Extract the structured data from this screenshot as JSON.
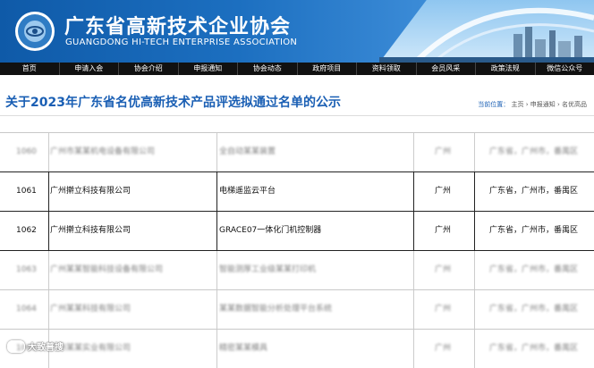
{
  "header": {
    "title_cn": "广东省高新技术企业协会",
    "title_en": "GUANGDONG HI-TECH ENTERPRISE ASSOCIATION",
    "logo_text": "GUANGDONG HI-TECH ENTERPRISE ASSOCIATION",
    "brand_color": "#1c6fc0"
  },
  "nav": {
    "items": [
      "首页",
      "申请入会",
      "协会介绍",
      "申报通知",
      "协会动态",
      "政府项目",
      "资料领取",
      "会员风采",
      "政策法规",
      "微信公众号"
    ]
  },
  "page": {
    "title": "关于2023年广东省名优高新技术产品评选拟通过名单的公示",
    "breadcrumb_label": "当前位置：",
    "breadcrumb": [
      "主页",
      "申报通知",
      "名优高品"
    ],
    "breadcrumb_sep": " › "
  },
  "table": {
    "rows": [
      {
        "no": "1060",
        "company": "广州市某某机电设备有限公司",
        "product": "全自动某某装置",
        "city": "广州",
        "region": "广东省，广州市，番禺区",
        "blurred": true
      },
      {
        "no": "1061",
        "company": "广州擀立科技有限公司",
        "product": "电梯遥监云平台",
        "city": "广州",
        "region": "广东省，广州市，番禺区",
        "blurred": false
      },
      {
        "no": "1062",
        "company": "广州擀立科技有限公司",
        "product": "GRACE07一体化门机控制器",
        "city": "广州",
        "region": "广东省，广州市，番禺区",
        "blurred": false
      },
      {
        "no": "1063",
        "company": "广州某某智能科技设备有限公司",
        "product": "智能测厚工业级某某打印机",
        "city": "广州",
        "region": "广东省，广州市，番禺区",
        "blurred": true
      },
      {
        "no": "1064",
        "company": "广州某某科技有限公司",
        "product": "某某数据智能分析处理平台系统",
        "city": "广州",
        "region": "广东省，广州市，番禺区",
        "blurred": true
      },
      {
        "no": "1065",
        "company": "广州某某实业有限公司",
        "product": "精密某某模具",
        "city": "广州",
        "region": "广东省，广州市，番禺区",
        "blurred": true
      }
    ]
  },
  "watermark": {
    "text": "大致普搜"
  }
}
